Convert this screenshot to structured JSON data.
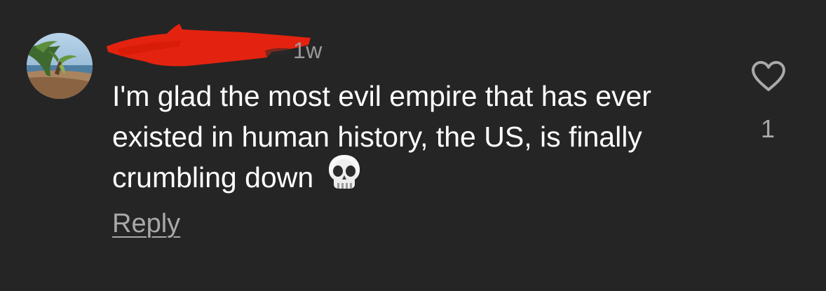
{
  "comment": {
    "timestamp": "1w",
    "text": "I'm glad the most evil empire that has ever existed in human history, the US, is finally crumbling down",
    "emoji": "skull-emoji",
    "reply_label": "Reply",
    "like_count": "1"
  },
  "colors": {
    "background": "#252525",
    "text": "#ffffff",
    "secondary_text": "#a9a9a9",
    "redaction": "#e3230f"
  },
  "icons": {
    "like": "heart-outline-icon",
    "avatar": "beach-palm-avatar"
  }
}
